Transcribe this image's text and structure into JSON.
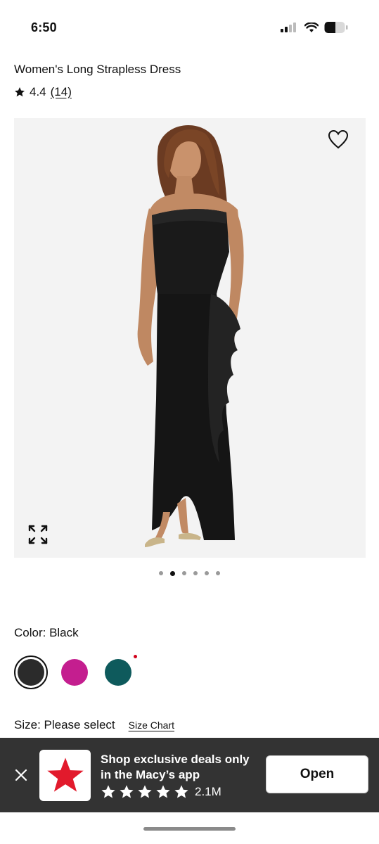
{
  "status_bar": {
    "time": "6:50"
  },
  "product": {
    "title": "Women's Long Strapless Dress",
    "rating": "4.4",
    "review_count": "(14)"
  },
  "gallery": {
    "image_count": 6,
    "active_index": 1
  },
  "color": {
    "label": "Color: Black",
    "swatches": [
      {
        "name": "Black",
        "hex": "#2b2b2b",
        "selected": true
      },
      {
        "name": "Pink",
        "hex": "#c41e8f",
        "selected": false
      },
      {
        "name": "Teal",
        "hex": "#0e5a5c",
        "selected": false
      }
    ]
  },
  "size": {
    "label": "Size: Please select",
    "chart_link": "Size Chart"
  },
  "app_banner": {
    "line1": "Shop exclusive deals only",
    "line2": "in the Macy’s app",
    "stars": 5,
    "downloads": "2.1M",
    "open_label": "Open",
    "logo_color": "#e21a2c"
  }
}
